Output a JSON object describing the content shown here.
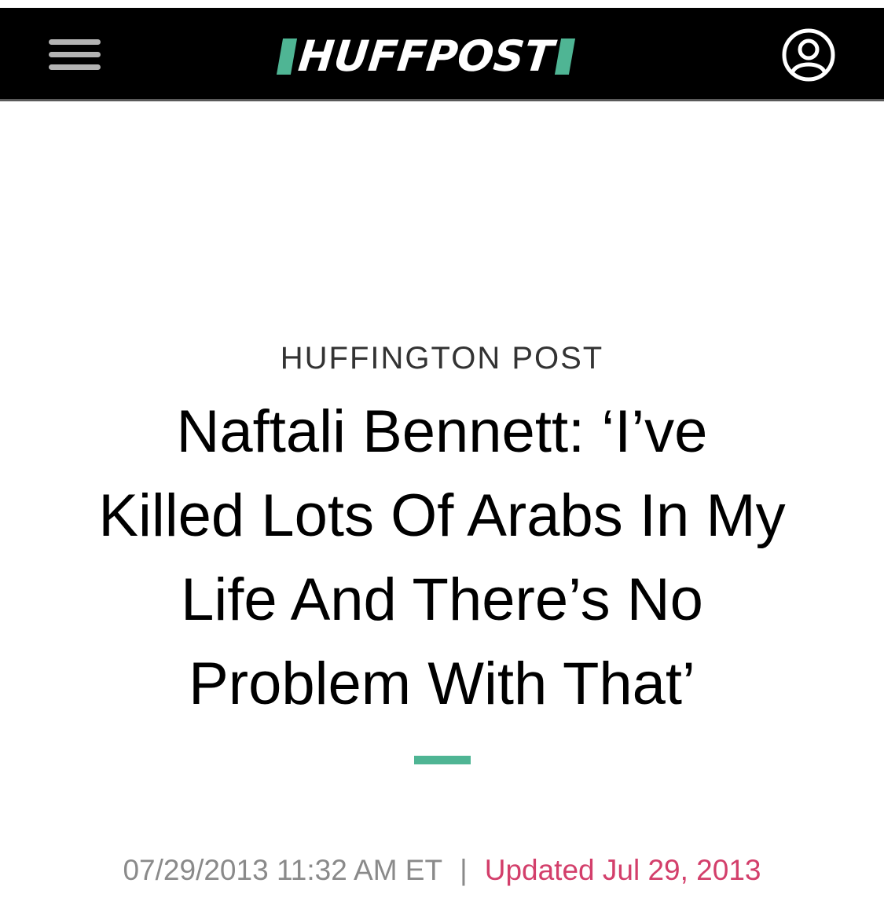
{
  "header": {
    "logo_text": "HUFFPOST",
    "menu_icon": "hamburger-menu-icon",
    "account_icon": "user-account-icon",
    "background_color": "#000000",
    "accent_color": "#4fb594"
  },
  "article": {
    "kicker": "HUFFINGTON POST",
    "headline_lines": [
      "Naftali Bennett: ‘I’ve",
      "Killed Lots Of Arabs In My",
      "Life And There’s No",
      "Problem With That’"
    ],
    "published": "07/29/2013 11:32 AM ET",
    "separator": "|",
    "updated": "Updated Jul 29, 2013",
    "updated_color": "#d33f6b"
  }
}
